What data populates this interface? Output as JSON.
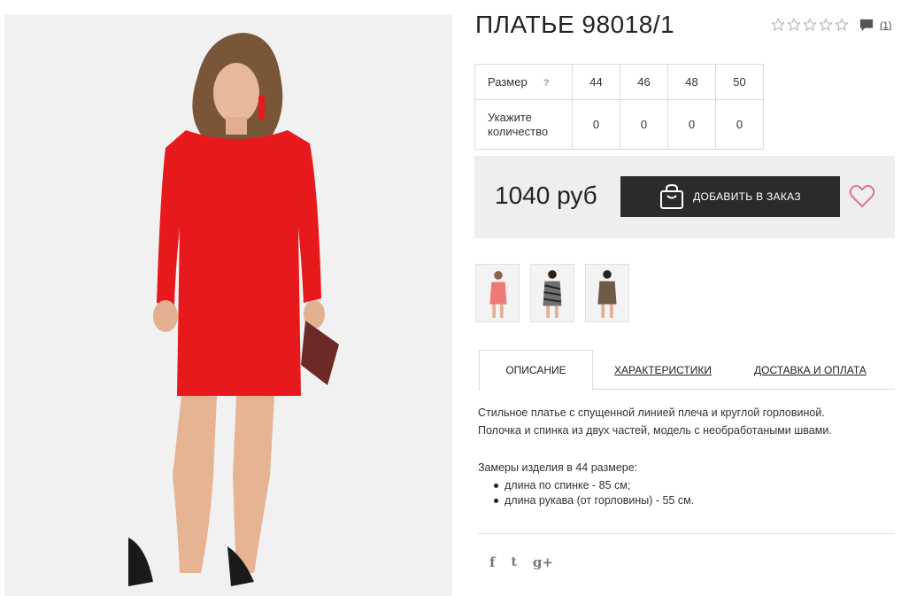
{
  "product": {
    "title": "ПЛАТЬЕ 98018/1",
    "rating_stars": 0,
    "rating_max": 5,
    "comment_count": "(1)",
    "price": "1040 руб",
    "add_to_order": "ДОБАВИТЬ В ЗАКАЗ"
  },
  "size_table": {
    "size_label": "Размер",
    "help": "?",
    "sizes": [
      "44",
      "46",
      "48",
      "50"
    ],
    "quantity_label_1": "Укажите",
    "quantity_label_2": "количество",
    "quantities": [
      "0",
      "0",
      "0",
      "0"
    ]
  },
  "thumbnails": [
    {
      "color": "#ec7b78"
    },
    {
      "color": "#4a4a4a"
    },
    {
      "color": "#6e5a47"
    }
  ],
  "tabs": [
    {
      "label": "ОПИСАНИЕ",
      "active": true
    },
    {
      "label": "ХАРАКТЕРИСТИКИ",
      "active": false
    },
    {
      "label": "ДОСТАВКА И ОПЛАТА",
      "active": false
    }
  ],
  "description": {
    "line1": "Стильное платье с спущенной линией плеча и круглой горловиной.",
    "line2": "Полочка и спинка из двух частей, модель с необработаными швами.",
    "measures_title": "Замеры изделия в 44 размере:",
    "measures": [
      "длина по спинке - 85 см;",
      "длина рукава (от горловины) - 55 см."
    ]
  },
  "social": {
    "facebook": "f",
    "twitter": "t",
    "google_plus": "g+"
  },
  "colors": {
    "dress_red": "#e8191c",
    "button_dark": "#2b2b2b",
    "heart_pink": "#e0738a",
    "price_bg": "#eeeeee"
  }
}
